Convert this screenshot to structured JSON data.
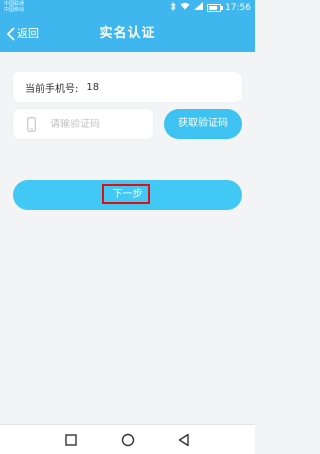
{
  "status_bar": {
    "carrier_1": "中国联通",
    "carrier_2": "中国移动",
    "time": "17:56",
    "battery_level": 0.8,
    "icons": [
      "bluetooth-icon",
      "wifi-icon",
      "signal-icon",
      "battery-icon"
    ]
  },
  "header": {
    "back_label": "返回",
    "title": "实名认证",
    "background": "#3fb6ee"
  },
  "form": {
    "phone_label": "当前手机号:",
    "phone_value": "18",
    "code_placeholder": "请输验证码",
    "code_value": "",
    "get_code_label": "获取验证码"
  },
  "next_button": {
    "label": "下一步",
    "highlight_color": "#e01010"
  },
  "nav_bar": {
    "buttons": [
      "recents-icon",
      "home-icon",
      "back-triangle-icon"
    ]
  }
}
